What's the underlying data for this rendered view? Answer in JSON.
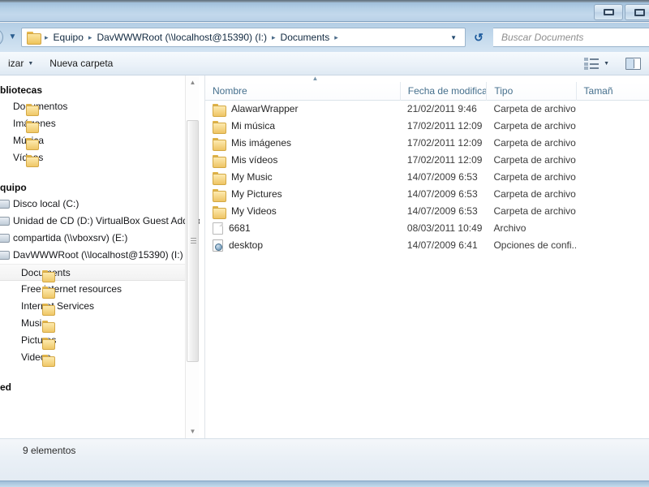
{
  "window": {
    "controls": [
      {
        "name": "restore-button",
        "glyph": "restore"
      },
      {
        "name": "close-button",
        "glyph": "close"
      }
    ]
  },
  "addressbar": {
    "folder_icon": "folder-icon",
    "back_icon": "back-navigation-icon",
    "recent_icon": "recent-locations-chevron-icon",
    "crumbs": [
      "Equipo",
      "DavWWWRoot (\\\\localhost@15390) (I:)",
      "Documents"
    ],
    "separator": "▸",
    "dropdown_icon": "chevron-down-icon",
    "refresh_icon": "refresh-icon",
    "refresh_glyph": "↺"
  },
  "search": {
    "placeholder": "Buscar Documents",
    "icon": "search-icon"
  },
  "toolbar": {
    "organize_label": "izar",
    "organize_caret": "▼",
    "new_folder_label": "Nueva carpeta",
    "view_icon": "view-options-icon",
    "view_caret": "▼",
    "preview_icon": "preview-pane-icon"
  },
  "sidebar": {
    "scrollbar": {
      "up_arrow": "▲",
      "down_arrow": "▼"
    },
    "groups": [
      {
        "header": "bliotecas",
        "header_name": "libraries-header",
        "items": [
          {
            "label": "Documentos",
            "icon": "folder-icon",
            "level": 1,
            "selected": false
          },
          {
            "label": "Imágenes",
            "icon": "folder-icon",
            "level": 1,
            "selected": false
          },
          {
            "label": "Música",
            "icon": "folder-icon",
            "level": 1,
            "selected": false
          },
          {
            "label": "Vídeos",
            "icon": "folder-icon",
            "level": 1,
            "selected": false
          }
        ]
      },
      {
        "header": "quipo",
        "header_name": "computer-header",
        "items": [
          {
            "label": "Disco local (C:)",
            "icon": "drive-icon",
            "level": 1,
            "selected": false
          },
          {
            "label": "Unidad de CD (D:) VirtualBox Guest Additio",
            "icon": "drive-icon",
            "level": 1,
            "selected": false
          },
          {
            "label": "compartida (\\\\vboxsrv) (E:)",
            "icon": "drive-icon",
            "level": 1,
            "selected": false
          },
          {
            "label": "DavWWWRoot (\\\\localhost@15390) (I:)",
            "icon": "drive-icon",
            "level": 1,
            "selected": false
          },
          {
            "label": "Documents",
            "icon": "folder-icon",
            "level": 2,
            "selected": true
          },
          {
            "label": "Free internet resources",
            "icon": "folder-icon",
            "level": 2,
            "selected": false
          },
          {
            "label": "Internet Services",
            "icon": "folder-icon",
            "level": 2,
            "selected": false
          },
          {
            "label": "Music",
            "icon": "folder-icon",
            "level": 2,
            "selected": false
          },
          {
            "label": "Pictures",
            "icon": "folder-icon",
            "level": 2,
            "selected": false
          },
          {
            "label": "Videos",
            "icon": "folder-icon",
            "level": 2,
            "selected": false
          }
        ]
      },
      {
        "header": "ed",
        "header_name": "network-header",
        "items": []
      }
    ]
  },
  "filelist": {
    "sort_indicator": "▲",
    "columns": [
      {
        "label": "Nombre",
        "key": "name"
      },
      {
        "label": "Fecha de modifica...",
        "key": "date"
      },
      {
        "label": "Tipo",
        "key": "type"
      },
      {
        "label": "Tamañ",
        "key": "size"
      }
    ],
    "rows": [
      {
        "name": "AlawarWrapper",
        "date": "21/02/2011 9:46",
        "type": "Carpeta de archivos",
        "size": "",
        "icon": "folder-icon"
      },
      {
        "name": "Mi música",
        "date": "17/02/2011 12:09",
        "type": "Carpeta de archivos",
        "size": "",
        "icon": "folder-icon"
      },
      {
        "name": "Mis imágenes",
        "date": "17/02/2011 12:09",
        "type": "Carpeta de archivos",
        "size": "",
        "icon": "folder-icon"
      },
      {
        "name": "Mis vídeos",
        "date": "17/02/2011 12:09",
        "type": "Carpeta de archivos",
        "size": "",
        "icon": "folder-icon"
      },
      {
        "name": "My Music",
        "date": "14/07/2009 6:53",
        "type": "Carpeta de archivos",
        "size": "",
        "icon": "folder-icon"
      },
      {
        "name": "My Pictures",
        "date": "14/07/2009 6:53",
        "type": "Carpeta de archivos",
        "size": "",
        "icon": "folder-icon"
      },
      {
        "name": "My Videos",
        "date": "14/07/2009 6:53",
        "type": "Carpeta de archivos",
        "size": "",
        "icon": "folder-icon"
      },
      {
        "name": "6681",
        "date": "08/03/2011 10:49",
        "type": "Archivo",
        "size": "",
        "icon": "file-icon"
      },
      {
        "name": "desktop",
        "date": "14/07/2009 6:41",
        "type": "Opciones de confi...",
        "size": "",
        "icon": "config-file-icon"
      }
    ]
  },
  "statusbar": {
    "item_count_text": "9 elementos",
    "back_icon": "back-arrow-icon"
  }
}
